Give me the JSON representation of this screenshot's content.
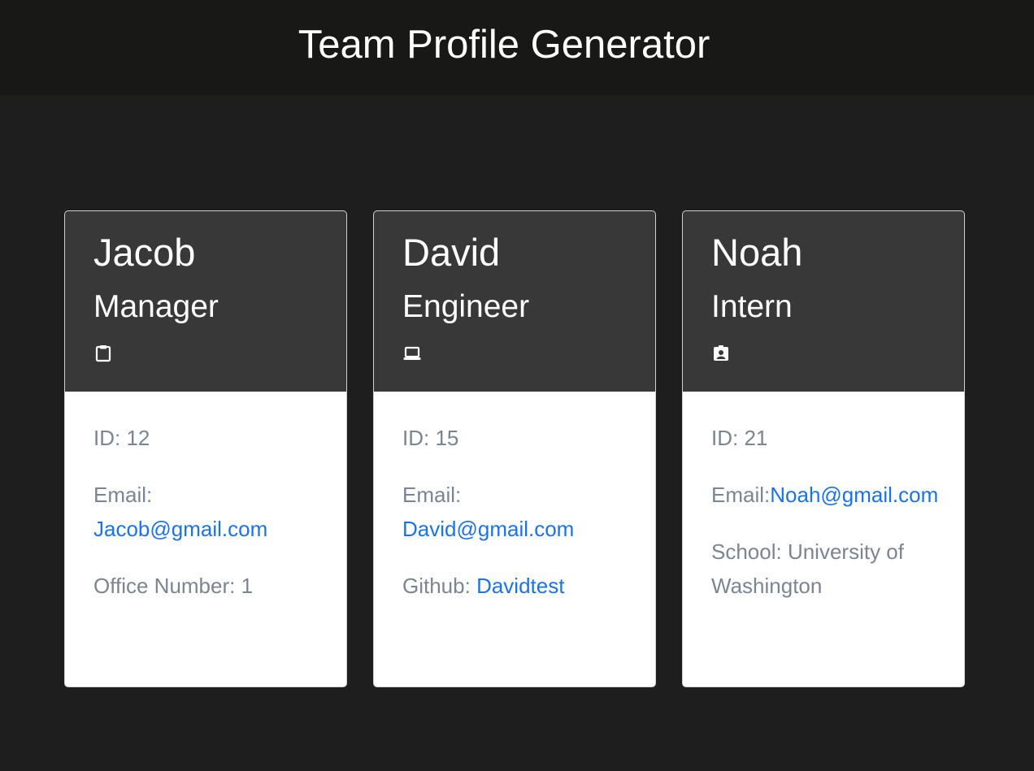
{
  "header": {
    "title": "Team Profile Generator"
  },
  "colors": {
    "page_bg": "#1e1e1e",
    "header_bg": "#181917",
    "card_header_bg": "#383838",
    "card_body_bg": "#ffffff",
    "link": "#1a73e8",
    "muted_text": "#7b8591"
  },
  "employees": [
    {
      "name": "Jacob",
      "role": "Manager",
      "icon": "clipboard-icon",
      "id_text": "ID: 12",
      "email_label": "Email: ",
      "email": "Jacob@gmail.com",
      "extra_label": "Office Number: 1",
      "extra_link": ""
    },
    {
      "name": "David",
      "role": "Engineer",
      "icon": "laptop-icon",
      "id_text": "ID: 15",
      "email_label": "Email: ",
      "email": "David@gmail.com",
      "extra_label": "Github: ",
      "extra_link": "Davidtest"
    },
    {
      "name": "Noah",
      "role": "Intern",
      "icon": "id-badge-icon",
      "id_text": "ID: 21",
      "email_label": "Email:",
      "email": "Noah@gmail.com",
      "extra_label": "School: University of Washington",
      "extra_link": ""
    }
  ]
}
